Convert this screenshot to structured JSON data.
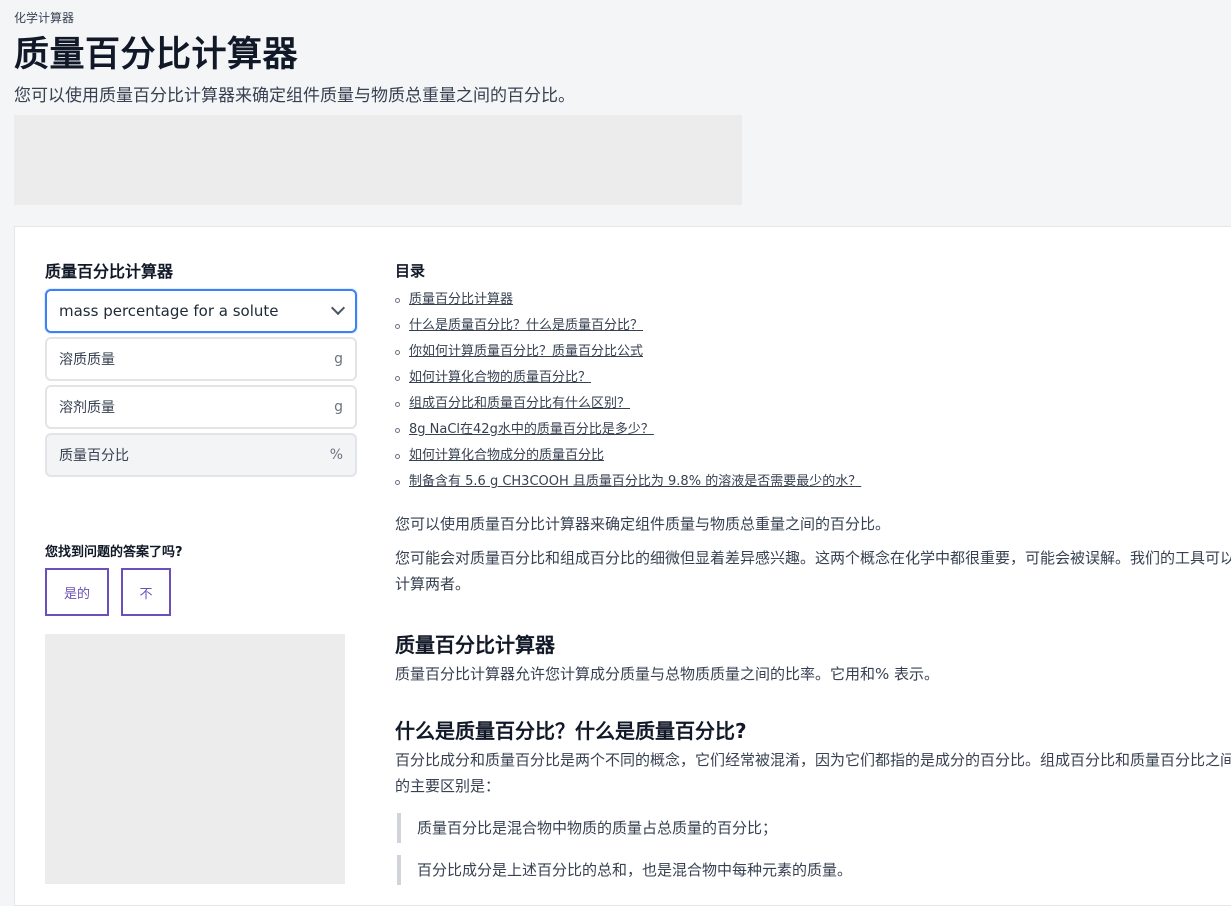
{
  "header": {
    "breadcrumb": "化学计算器",
    "title": "质量百分比计算器",
    "subtitle": "您可以使用质量百分比计算器来确定组件质量与物质总重量之间的百分比。"
  },
  "calculator": {
    "title": "质量百分比计算器",
    "mode_select": "mass percentage for a solute",
    "fields": [
      {
        "label": "溶质质量",
        "unit": "g"
      },
      {
        "label": "溶剂质量",
        "unit": "g"
      },
      {
        "label": "质量百分比",
        "unit": "%"
      }
    ]
  },
  "feedback": {
    "question": "您找到问题的答案了吗?",
    "yes": "是的",
    "no": "不"
  },
  "toc": {
    "title": "目录",
    "items": [
      "质量百分比计算器",
      "什么是质量百分比？什么是质量百分比？",
      "你如何计算质量百分比？质量百分比公式",
      "如何计算化合物的质量百分比？",
      "组成百分比和质量百分比有什么区别？",
      "8g NaCl在42g水中的质量百分比是多少？",
      "如何计算化合物成分的质量百分比",
      "制备含有 5.6 g CH3COOH 且质量百分比为 9.8% 的溶液是否需要最少的水？"
    ]
  },
  "article": {
    "intro1": "您可以使用质量百分比计算器来确定组件质量与物质总重量之间的百分比。",
    "intro2": "您可能会对质量百分比和组成百分比的细微但显着差异感兴趣。这两个概念在化学中都很重要，可能会被误解。我们的工具可以计算两者。",
    "section1_title": "质量百分比计算器",
    "section1_text": "质量百分比计算器允许您计算成分质量与总物质质量之间的比率。它用和% 表示。",
    "section2_title": "什么是质量百分比？什么是质量百分比?",
    "section2_text": "百分比成分和质量百分比是两个不同的概念，它们经常被混淆，因为它们都指的是成分的百分比。组成百分比和质量百分比之间的主要区别是：",
    "quote1": "质量百分比是混合物中物质的质量占总质量的百分比；",
    "quote2": "百分比成分是上述百分比的总和，也是混合物中每种元素的质量。"
  },
  "colors": {
    "accent_blue": "#3b82f6",
    "feedback_purple": "#6b4fbb",
    "placeholder_gray": "#ececec"
  },
  "icons": {
    "select_chevron": "chevron-down-icon",
    "toc_bullet": "circle-bullet-icon"
  }
}
